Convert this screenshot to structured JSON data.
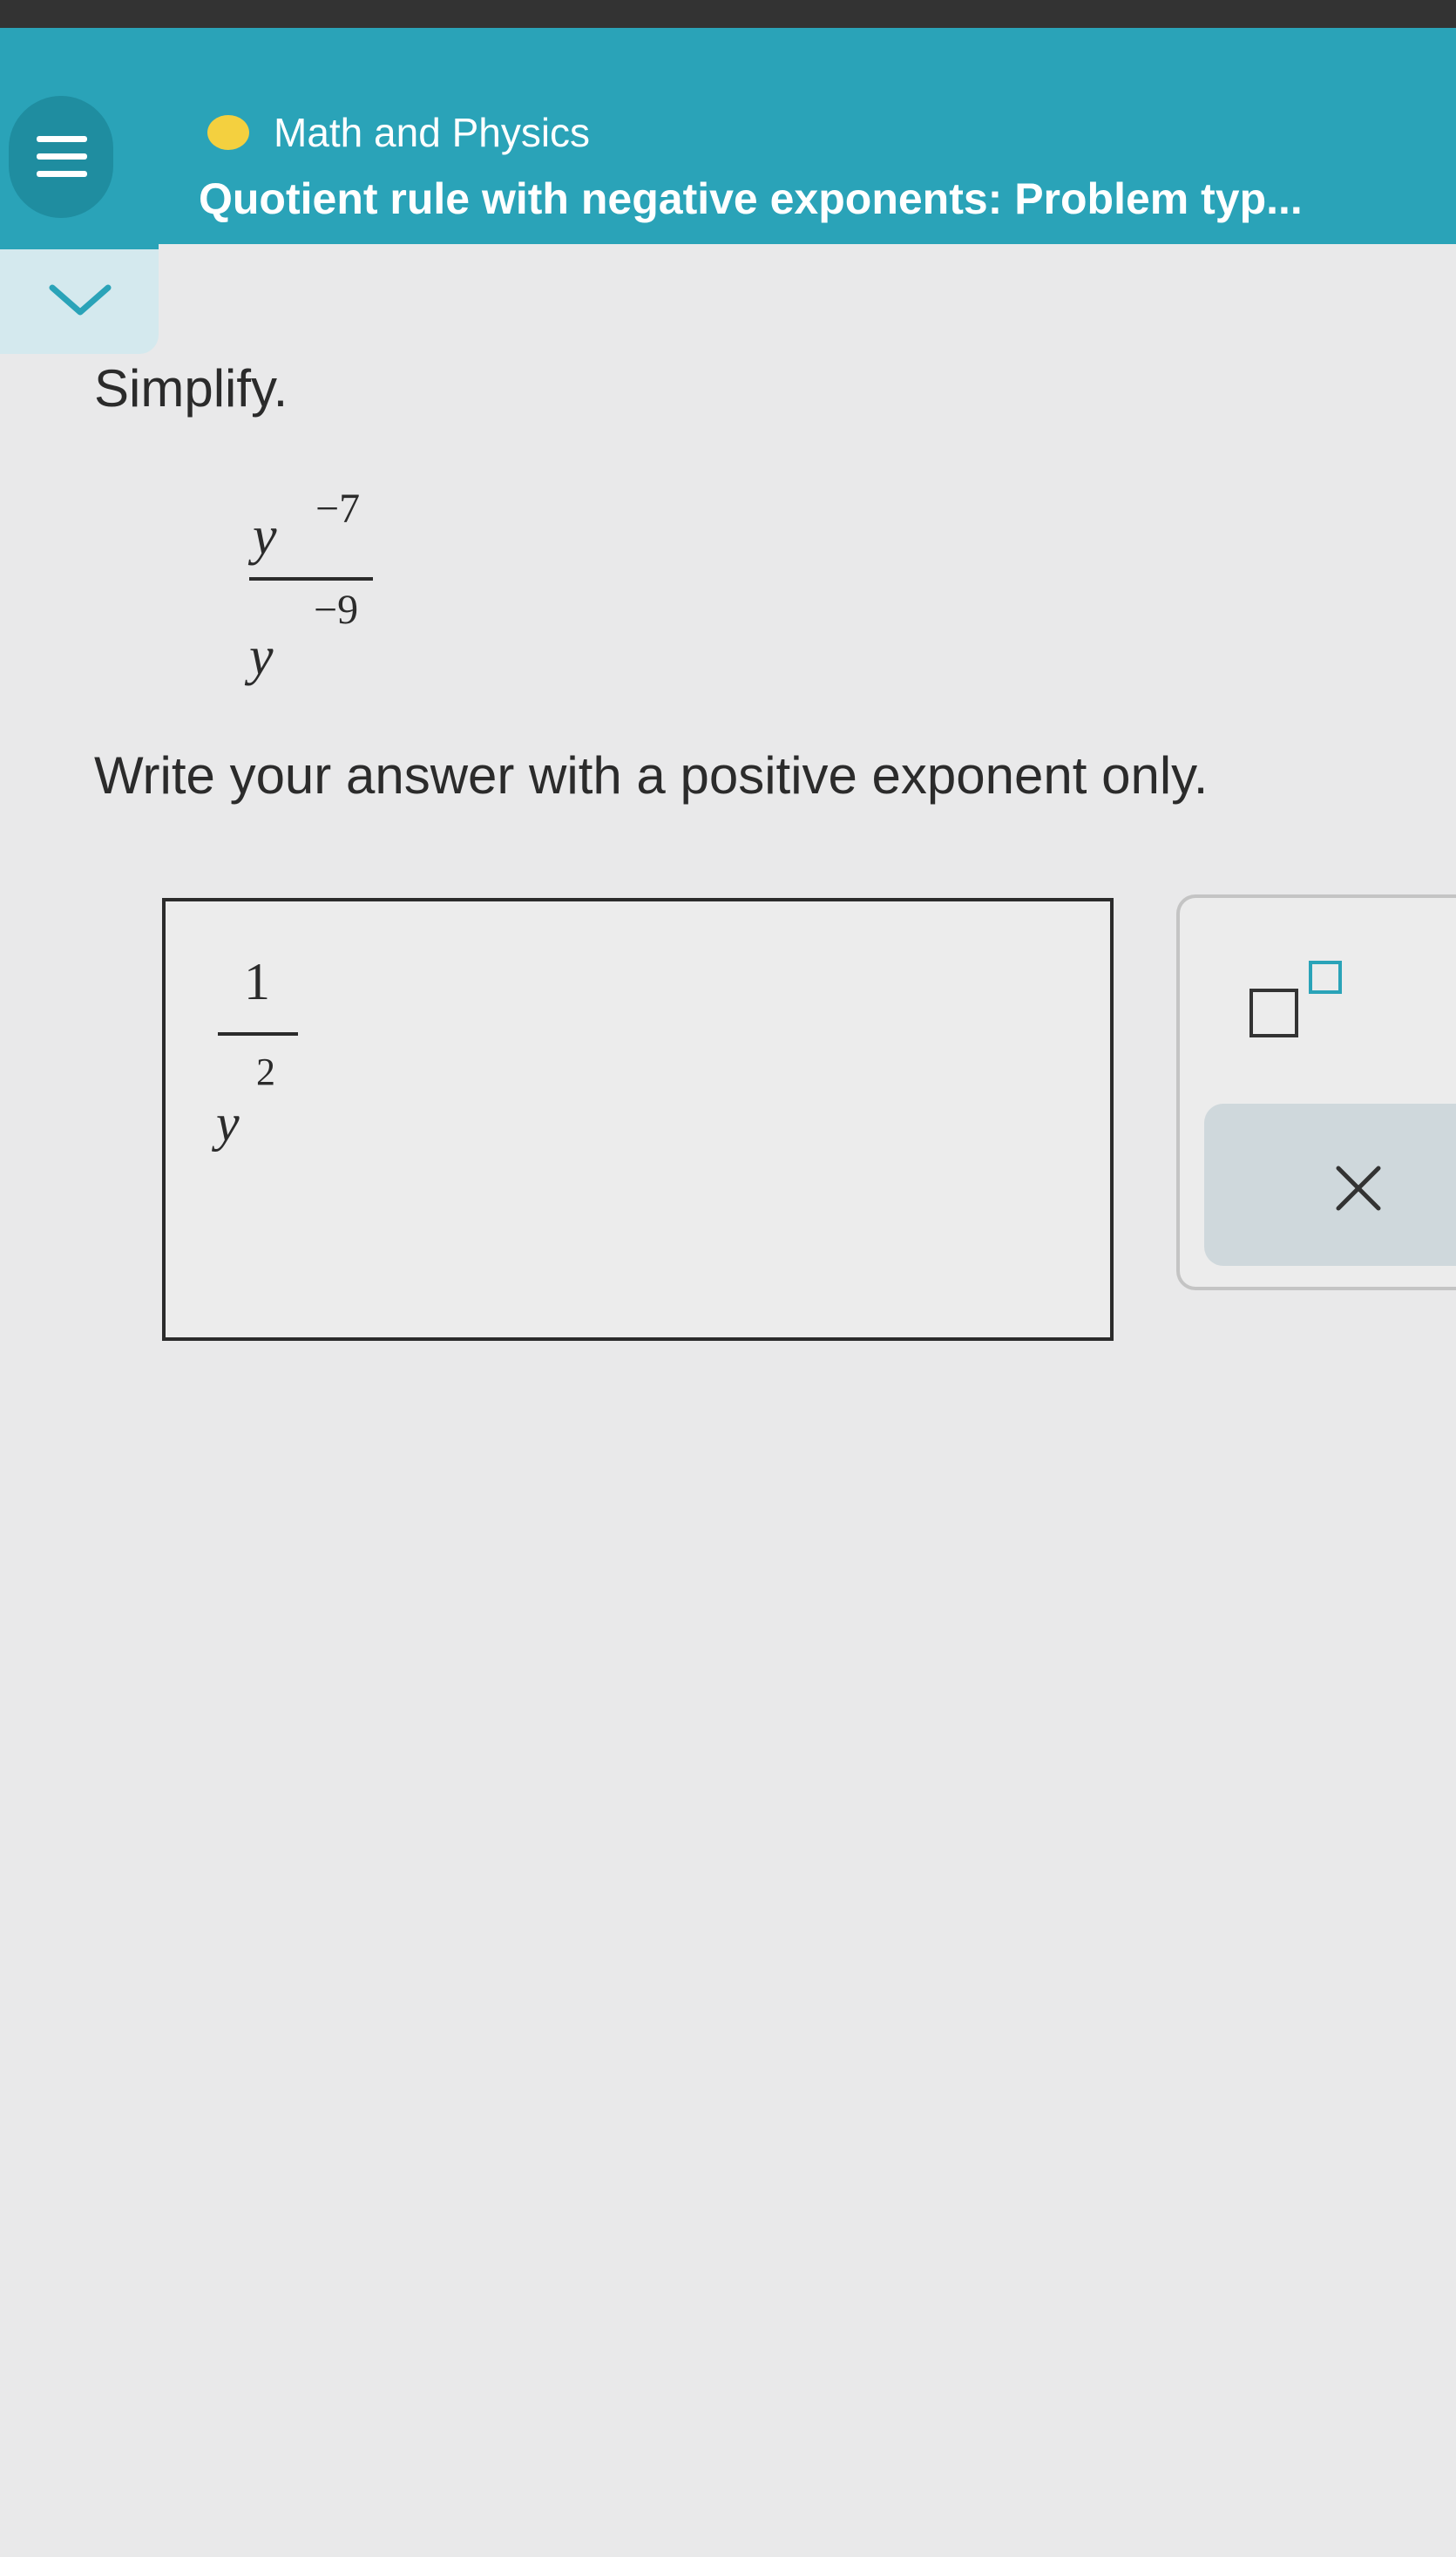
{
  "header": {
    "category": "Math and Physics",
    "topic_title": "Quotient rule with negative exponents: Problem typ...",
    "accent_color": "#2aa3b8",
    "category_dot_color": "#f4d03f"
  },
  "icons": {
    "menu": "hamburger-menu-icon",
    "collapse": "chevron-down-icon",
    "exponent_tool": "superscript-template-icon",
    "clear": "close-icon"
  },
  "problem": {
    "instruction": "Simplify.",
    "numerator_base": "y",
    "numerator_exponent": "−7",
    "denominator_base": "y",
    "denominator_exponent": "−9",
    "answer_instruction": "Write your answer with a positive exponent only."
  },
  "answer": {
    "numerator": "1",
    "denominator_base": "y",
    "denominator_exponent": "2"
  }
}
